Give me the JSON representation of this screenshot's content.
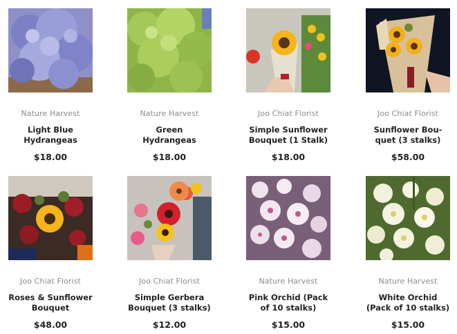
{
  "products": [
    {
      "vendor": "Nature Harvest",
      "name_line1": "Light Blue",
      "name_line2": "Hydrangeas",
      "price": "$18.00",
      "image": "light-blue-hydrangea-photo"
    },
    {
      "vendor": "Nature Harvest",
      "name_line1": "Green",
      "name_line2": "Hydrangeas",
      "price": "$18.00",
      "image": "green-hydrangea-photo"
    },
    {
      "vendor": "Joo Chiat Florist",
      "name_line1": "Simple Sunflower",
      "name_line2": "Bouquet (1 Stalk)",
      "price": "$18.00",
      "image": "sunflower-bouquet-photo"
    },
    {
      "vendor": "Joo Chiat Florist",
      "name_line1": "Sunflower Bou-",
      "name_line2": "quet (3 stalks)",
      "price": "$58.00",
      "image": "three-sunflower-bouquet-photo"
    },
    {
      "vendor": "Joo Chiat Florist",
      "name_line1": "Roses & Sunflower",
      "name_line2": "Bouquet",
      "price": "$48.00",
      "image": "roses-sunflower-bouquet-photo"
    },
    {
      "vendor": "Joo Chiat Florist",
      "name_line1": "Simple Gerbera",
      "name_line2": "Bouquet (3 stalks)",
      "price": "$12.00",
      "image": "gerbera-bouquet-photo"
    },
    {
      "vendor": "Nature Harvest",
      "name_line1": "Pink Orchid (Pack",
      "name_line2": "of 10 stalks)",
      "price": "$15.00",
      "image": "pink-orchid-photo"
    },
    {
      "vendor": "Nature Harvest",
      "name_line1": "White Orchid",
      "name_line2": "(Pack of 10 stalks)",
      "price": "$15.00",
      "image": "white-orchid-photo"
    }
  ]
}
